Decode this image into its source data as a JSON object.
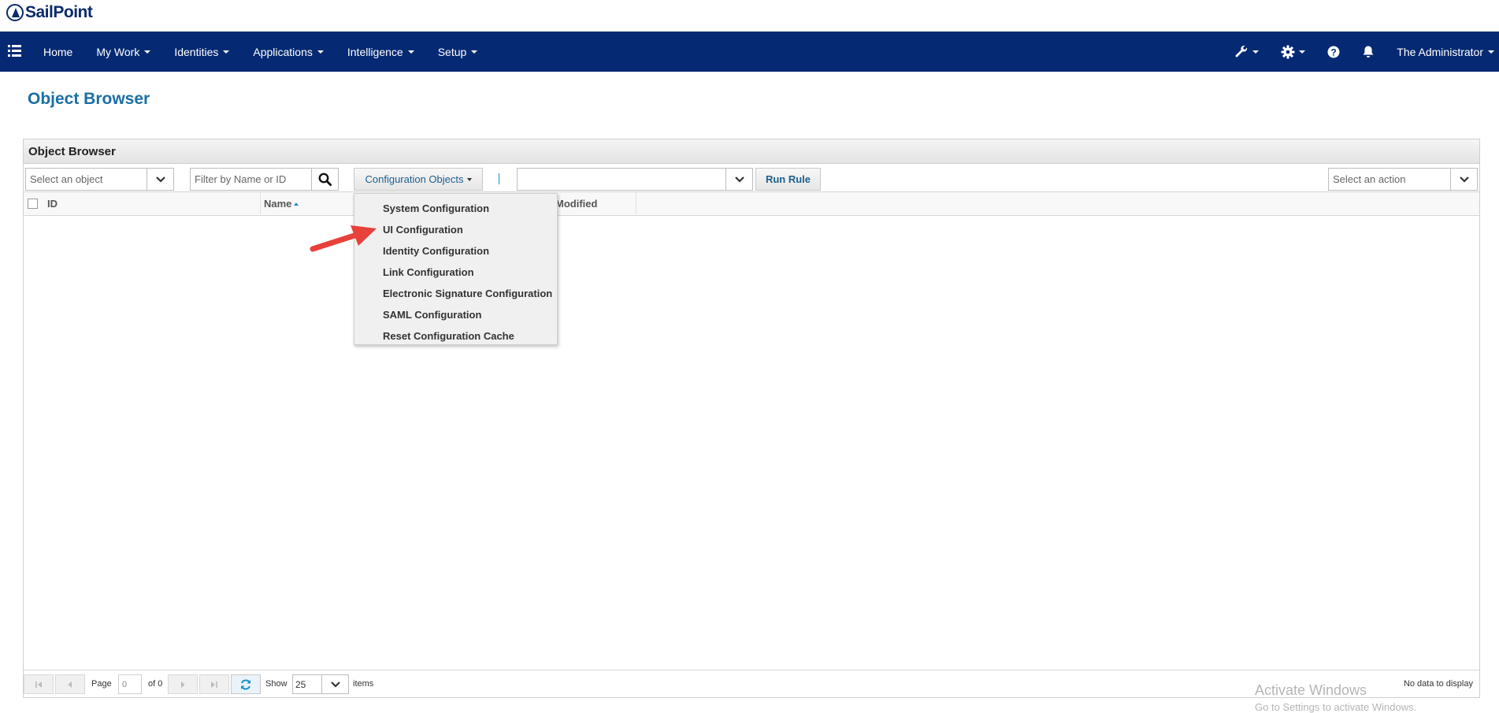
{
  "app": {
    "logo_text": "SailPoint"
  },
  "nav": {
    "items": [
      {
        "label": "Home",
        "has_caret": false
      },
      {
        "label": "My Work",
        "has_caret": true
      },
      {
        "label": "Identities",
        "has_caret": true
      },
      {
        "label": "Applications",
        "has_caret": true
      },
      {
        "label": "Intelligence",
        "has_caret": true
      },
      {
        "label": "Setup",
        "has_caret": true
      }
    ],
    "right_icons": [
      "wrench-icon",
      "gear-icon",
      "help-icon",
      "bell-icon"
    ],
    "user_label": "The Administrator",
    "bg_color": "#052a73"
  },
  "page": {
    "title": "Object Browser"
  },
  "panel": {
    "title": "Object Browser",
    "select_object_placeholder": "Select an object",
    "filter_placeholder": "Filter by Name or ID",
    "config_objects_label": "Configuration Objects",
    "rule_select_value": "",
    "run_rule_label": "Run Rule",
    "select_action_placeholder": "Select an action",
    "columns": {
      "id": "ID",
      "name": "Name",
      "modified": "Modified"
    }
  },
  "dropdown": {
    "items": [
      "System Configuration",
      "UI Configuration",
      "Identity Configuration",
      "Link Configuration",
      "Electronic Signature Configuration",
      "SAML Configuration",
      "Reset Configuration Cache"
    ]
  },
  "pager": {
    "page_label": "Page",
    "page_value": "0",
    "of_label": "of 0",
    "show_label": "Show",
    "show_value": "25",
    "items_label": "items",
    "no_data": "No data to display"
  },
  "watermark": {
    "title": "Activate Windows",
    "subtitle": "Go to Settings to activate Windows."
  },
  "colors": {
    "title_blue": "#1b6fa3",
    "annotation_arrow": "#e8403a"
  }
}
